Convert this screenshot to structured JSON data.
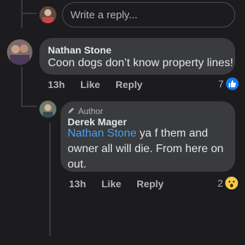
{
  "reply_box": {
    "placeholder": "Write a reply..."
  },
  "comment1": {
    "author": "Nathan Stone",
    "text": "Coon dogs don’t know property lines!",
    "time": "13h",
    "like_label": "Like",
    "reply_label": "Reply",
    "reaction_count": "7",
    "reaction_icon": "like-icon"
  },
  "comment2": {
    "badge": "Author",
    "author": "Derek Mager",
    "mention": "Nathan Stone",
    "text_line1": " ya f them and",
    "text_line2": "owner all will die. From here on",
    "text_line3": "out.",
    "time": "13h",
    "like_label": "Like",
    "reply_label": "Reply",
    "reaction_count": "2",
    "reaction_icon": "wow-icon"
  },
  "colors": {
    "background": "#1c1c1e",
    "bubble": "#3a3b3c",
    "mention": "#4a9ff5",
    "like_blue": "#1877f2"
  }
}
